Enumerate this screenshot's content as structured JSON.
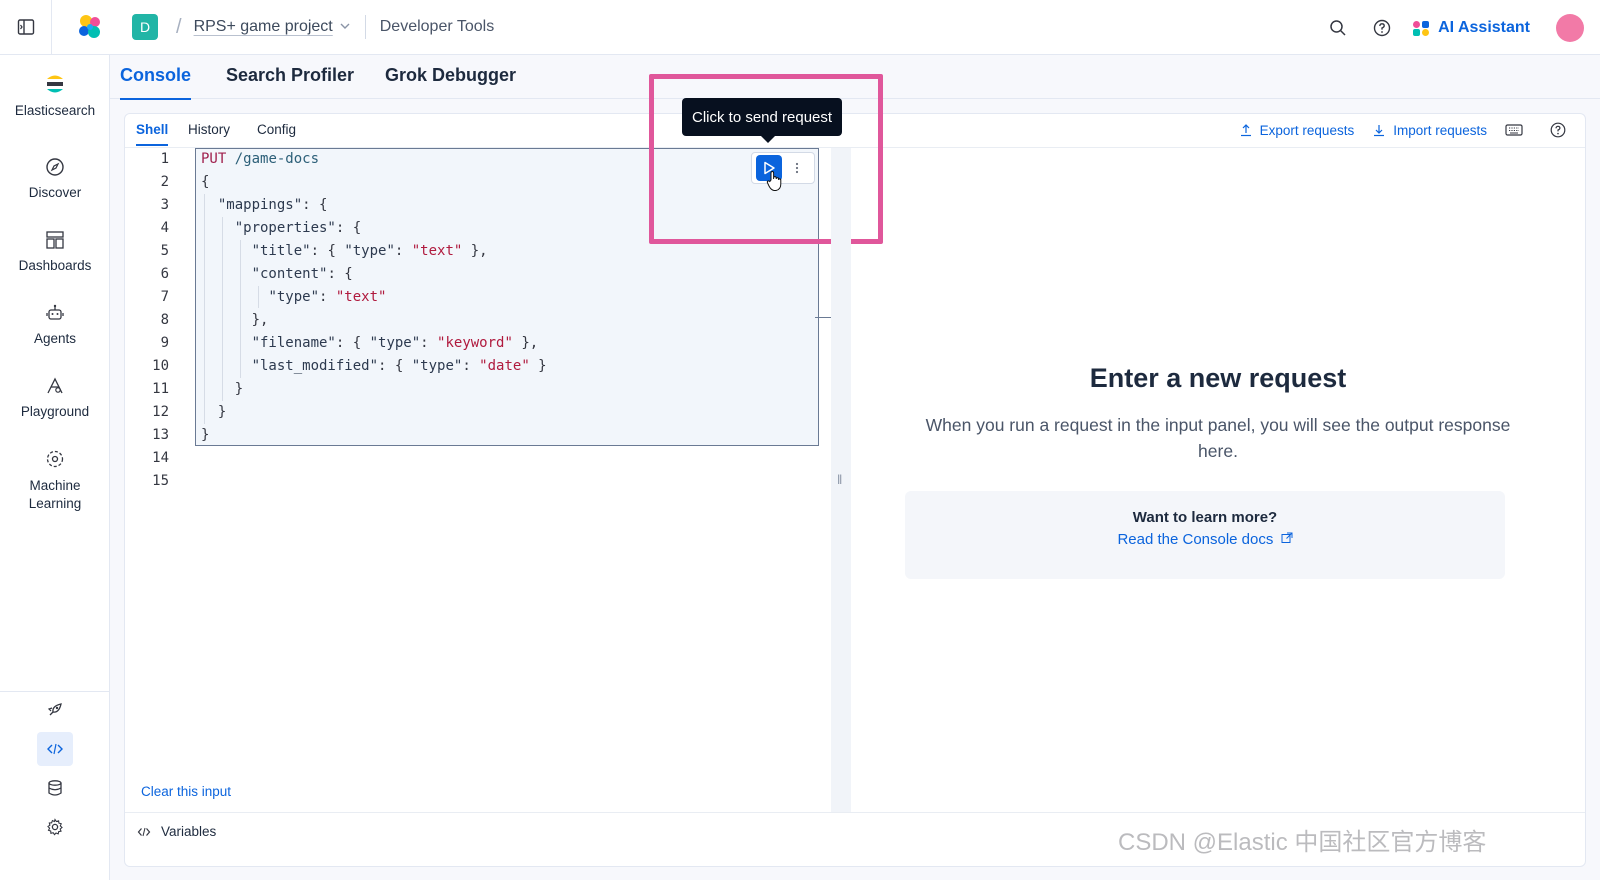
{
  "header": {
    "space_initial": "D",
    "project": "RPS+ game project",
    "page": "Developer Tools",
    "ai_assistant": "AI Assistant"
  },
  "sidebar": {
    "brand": "Elasticsearch",
    "items": [
      {
        "label": "Discover",
        "icon": "compass-icon"
      },
      {
        "label": "Dashboards",
        "icon": "dashboard-icon"
      },
      {
        "label": "Agents",
        "icon": "robot-icon"
      },
      {
        "label": "Playground",
        "icon": "playground-icon"
      },
      {
        "label": "Machine Learning",
        "icon": "ml-icon"
      }
    ],
    "bottom_icons": [
      "rocket-icon",
      "code-icon",
      "database-icon",
      "gear-icon"
    ]
  },
  "app_tabs": [
    {
      "label": "Console",
      "active": true
    },
    {
      "label": "Search Profiler",
      "active": false
    },
    {
      "label": "Grok Debugger",
      "active": false
    }
  ],
  "sub_tabs": [
    {
      "label": "Shell",
      "active": true
    },
    {
      "label": "History",
      "active": false
    },
    {
      "label": "Config",
      "active": false
    }
  ],
  "actions": {
    "export": "Export requests",
    "import": "Import requests"
  },
  "tooltip": "Click to send request",
  "editor": {
    "line_numbers": [
      "1",
      "2",
      "3",
      "4",
      "5",
      "6",
      "7",
      "8",
      "9",
      "10",
      "11",
      "12",
      "13",
      "14",
      "15"
    ],
    "clear_label": "Clear this input",
    "variables_label": "Variables"
  },
  "output": {
    "title": "Enter a new request",
    "description": "When you run a request in the input panel, you will see the output response here.",
    "learn_title": "Want to learn more?",
    "learn_link": "Read the Console docs"
  },
  "watermark": "CSDN @Elastic 中国社区官方博客",
  "colors": {
    "accent": "#0b64dd",
    "highlight": "#e0579b",
    "space_badge": "#21b5a6",
    "avatar": "#f27aa7"
  }
}
